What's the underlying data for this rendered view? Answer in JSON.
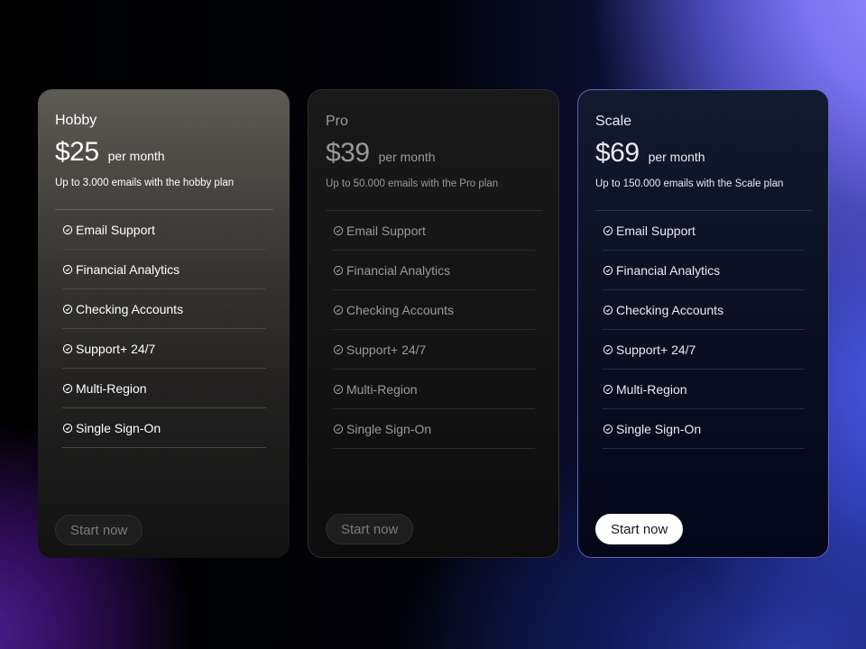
{
  "plans": [
    {
      "name": "Hobby",
      "price": "$25",
      "period": "per month",
      "description": "Up to 3.000 emails with the hobby plan",
      "features": [
        "Email Support",
        "Financial Analytics",
        "Checking Accounts",
        "Support+ 24/7",
        "Multi-Region",
        "Single Sign-On"
      ],
      "button_label": "Start now",
      "feature_icon": "circle-check-icon"
    },
    {
      "name": "Pro",
      "price": "$39",
      "period": "per month",
      "description": "Up to 50.000 emails with the Pro plan",
      "features": [
        "Email Support",
        "Financial Analytics",
        "Checking Accounts",
        "Support+ 24/7",
        "Multi-Region",
        "Single Sign-On"
      ],
      "button_label": "Start now",
      "feature_icon": "circle-check-icon"
    },
    {
      "name": "Scale",
      "price": "$69",
      "period": "per month",
      "description": "Up to 150.000 emails with the Scale plan",
      "features": [
        "Email Support",
        "Financial Analytics",
        "Checking Accounts",
        "Support+ 24/7",
        "Multi-Region",
        "Single Sign-On"
      ],
      "button_label": "Start now",
      "feature_icon": "circle-check-icon"
    }
  ],
  "colors": {
    "scale_button_bg": "#ffffff",
    "accent_gradient": "#8f86ff"
  }
}
